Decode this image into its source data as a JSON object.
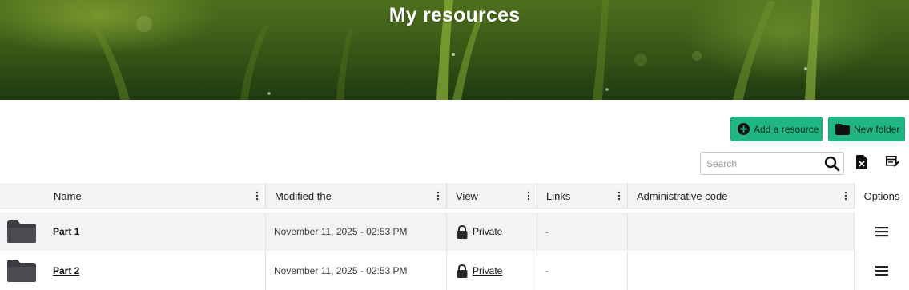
{
  "page": {
    "title": "My resources"
  },
  "toolbar": {
    "add_resource_label": "Add a resource",
    "new_folder_label": "New folder",
    "search_placeholder": "Search"
  },
  "colors": {
    "accent_button": "#21b582",
    "banner": "#3c5d18"
  },
  "icons": {
    "add": "plus-circle-icon",
    "folder": "folder-icon",
    "search": "search-icon",
    "export": "export-file-icon",
    "edit_columns": "edit-table-icon",
    "column_menu": "vertical-dots-icon",
    "lock": "lock-icon",
    "row_menu": "hamburger-icon"
  },
  "table": {
    "columns": [
      "Name",
      "Modified the",
      "View",
      "Links",
      "Administrative code",
      "Options"
    ],
    "rows": [
      {
        "name": "Part 1",
        "modified": "November 11, 2025 - 02:53 PM",
        "view": "Private",
        "links": "-",
        "admin_code": ""
      },
      {
        "name": "Part 2",
        "modified": "November 11, 2025 - 02:53 PM",
        "view": "Private",
        "links": "-",
        "admin_code": ""
      }
    ]
  }
}
